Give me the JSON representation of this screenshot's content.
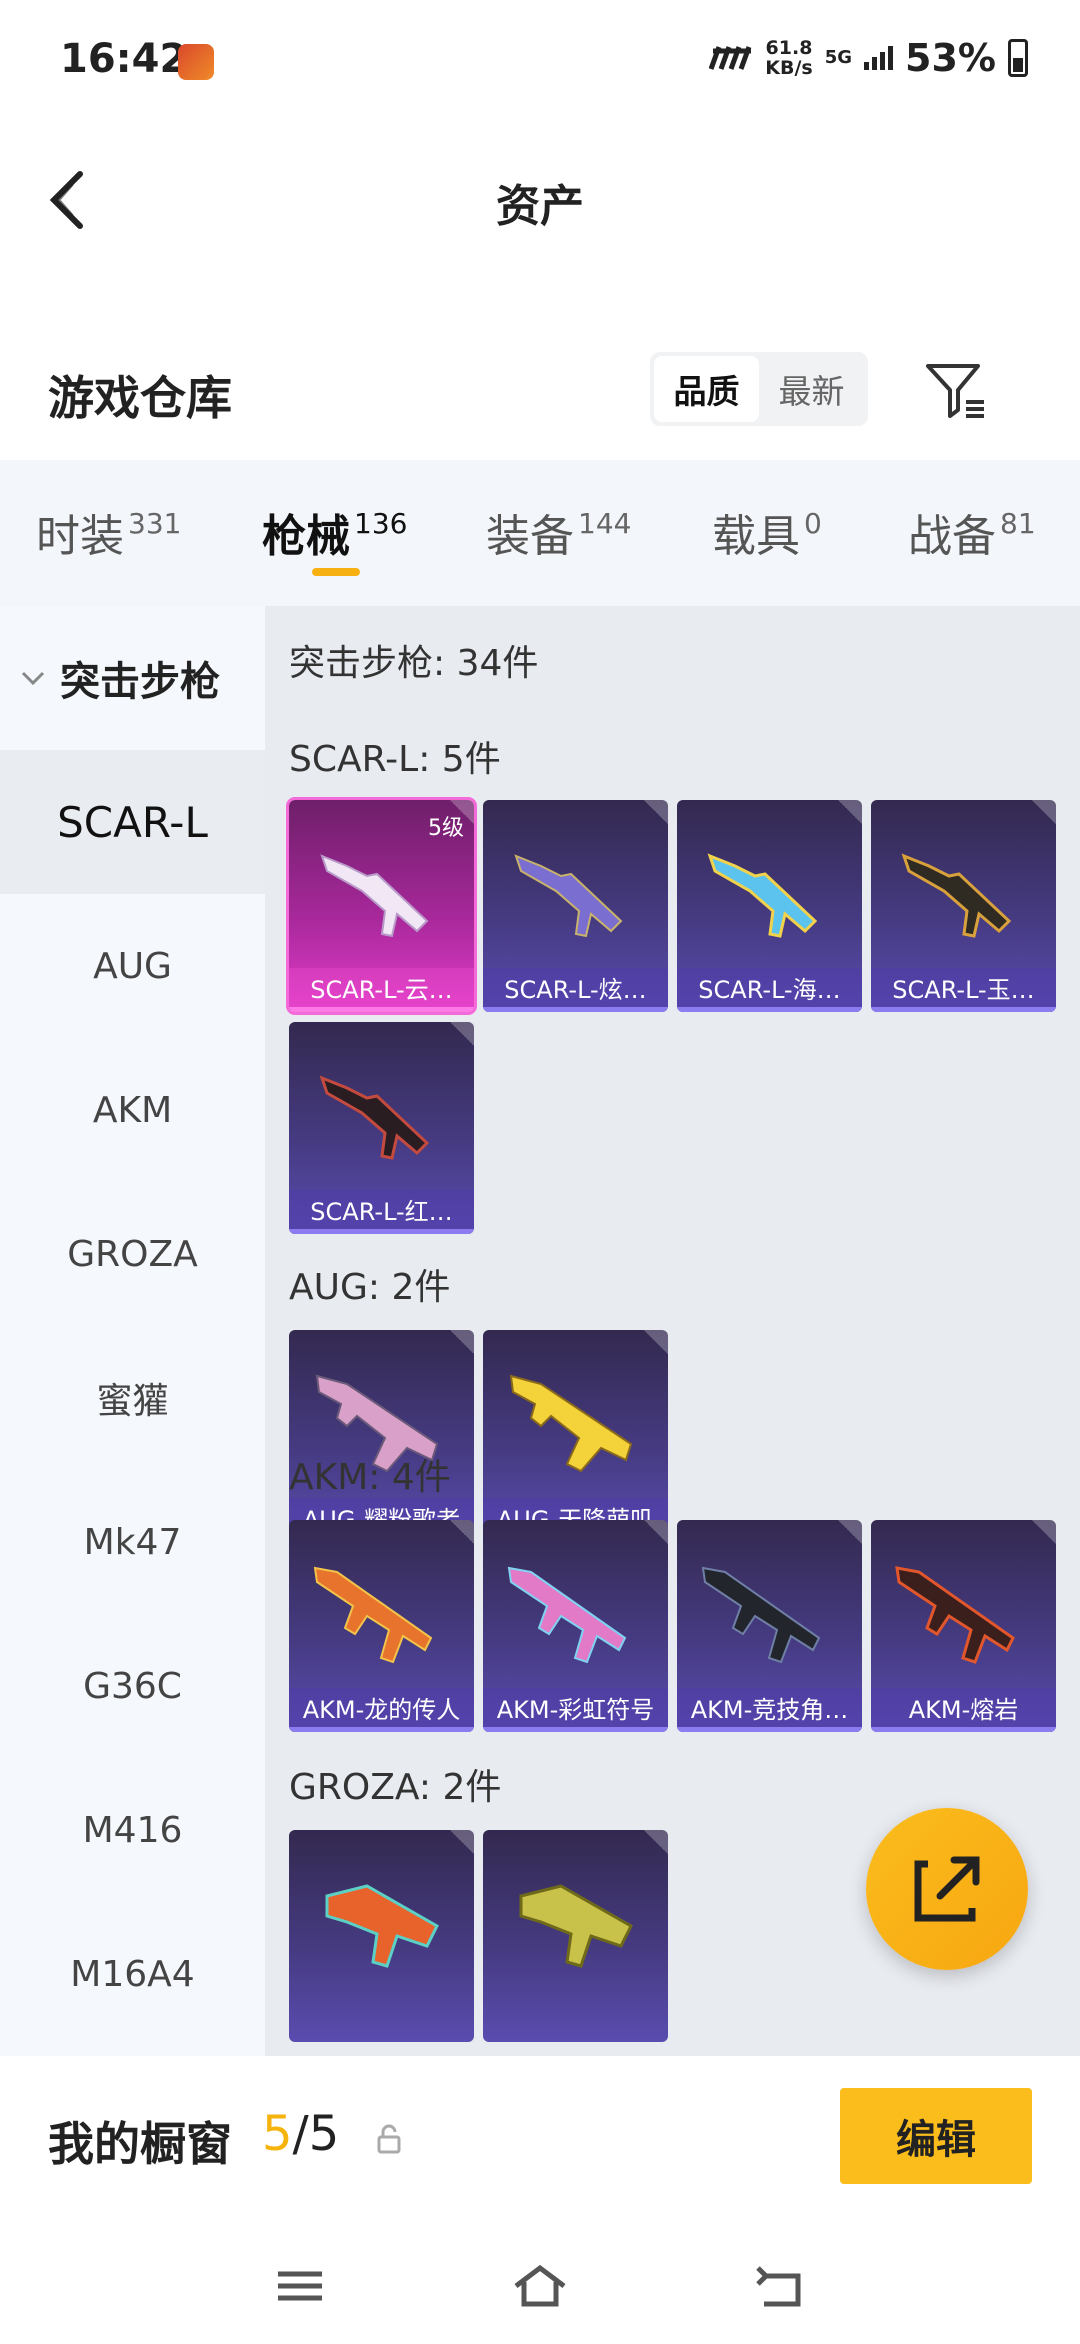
{
  "status_bar": {
    "time": "16:42",
    "net_speed_value": "61.8",
    "net_speed_unit": "KB/s",
    "network": "5G",
    "battery": "53%"
  },
  "nav": {
    "title": "资产"
  },
  "warehouse": {
    "title": "游戏仓库",
    "sort_options": [
      "品质",
      "最新"
    ],
    "sort_selected": "品质"
  },
  "tabs": [
    {
      "label": "时装",
      "count": "331"
    },
    {
      "label": "枪械",
      "count": "136"
    },
    {
      "label": "装备",
      "count": "144"
    },
    {
      "label": "载具",
      "count": "0"
    },
    {
      "label": "战备",
      "count": "81"
    }
  ],
  "active_tab": "枪械",
  "sidebar": {
    "category": "突击步枪",
    "items": [
      "SCAR-L",
      "AUG",
      "AKM",
      "GROZA",
      "蜜獾",
      "Mk47",
      "G36C",
      "M416",
      "M16A4"
    ],
    "selected": "SCAR-L"
  },
  "content": {
    "summary": "突击步枪: 34件",
    "sections": [
      {
        "title": "SCAR-L: 5件",
        "items": [
          {
            "name": "SCAR-L-云…",
            "level": "5级",
            "rarity": "legendary"
          },
          {
            "name": "SCAR-L-炫…"
          },
          {
            "name": "SCAR-L-海…"
          },
          {
            "name": "SCAR-L-玉…"
          },
          {
            "name": "SCAR-L-红…"
          }
        ]
      },
      {
        "title": "AUG: 2件",
        "items": [
          {
            "name": "AUG-耀粉歌者"
          },
          {
            "name": "AUG-天降萌叽"
          }
        ]
      },
      {
        "title": "AKM: 4件",
        "items": [
          {
            "name": "AKM-龙的传人"
          },
          {
            "name": "AKM-彩虹符号"
          },
          {
            "name": "AKM-竞技角…"
          },
          {
            "name": "AKM-熔岩"
          }
        ]
      },
      {
        "title": "GROZA: 2件",
        "items": [
          {
            "name": ""
          },
          {
            "name": ""
          }
        ]
      }
    ]
  },
  "showcase": {
    "title": "我的橱窗",
    "count_current": "5",
    "count_sep": "/",
    "count_total": "5",
    "edit_label": "编辑"
  },
  "colors": {
    "accent": "#fbbd1c",
    "tab_indicator": "#f7b011",
    "legendary": "#e23cc9",
    "card_base": "#473c85"
  },
  "icons": {
    "back": "back-arrow-icon",
    "filter": "filter-icon",
    "share": "share-external-icon",
    "lock": "lock-icon",
    "menu": "menu-icon",
    "home": "home-icon",
    "return": "return-icon"
  }
}
